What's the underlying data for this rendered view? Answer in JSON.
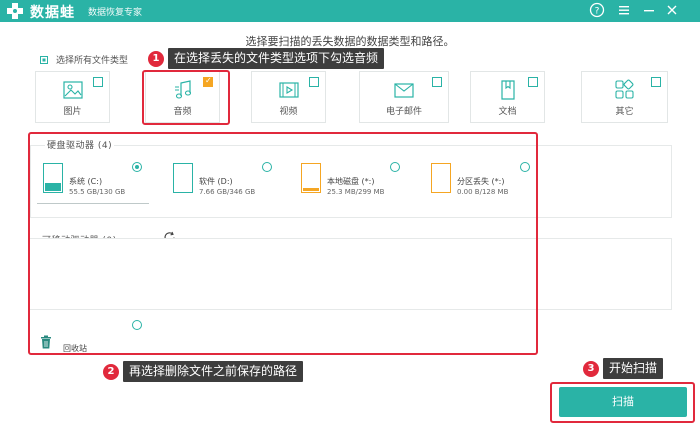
{
  "titlebar": {
    "app_name": "数据蛙",
    "app_subtitle": "数据恢复专家"
  },
  "instruction": "选择要扫描的丢失数据的数据类型和路径。",
  "select_all_label": "选择所有文件类型",
  "file_types": [
    {
      "label": "图片",
      "checked": false
    },
    {
      "label": "音频",
      "checked": true
    },
    {
      "label": "视频",
      "checked": false
    },
    {
      "label": "电子邮件",
      "checked": false
    },
    {
      "label": "文档",
      "checked": false
    },
    {
      "label": "其它",
      "checked": false
    }
  ],
  "hard_drives": {
    "title": "硬盘驱动器 (4)",
    "drives": [
      {
        "name": "系统 (C:)",
        "size": "55.5 GB/130 GB",
        "selected": true
      },
      {
        "name": "软件 (D:)",
        "size": "7.66 GB/346 GB",
        "selected": false
      },
      {
        "name": "本地磁盘 (*:)",
        "size": "25.3 MB/299 MB",
        "selected": false
      },
      {
        "name": "分区丢失 (*:)",
        "size": "0.00 B/128 MB",
        "selected": false
      }
    ]
  },
  "removable": {
    "title": "可移动驱动器 (0)"
  },
  "recycle_bin_label": "回收站",
  "annotations": {
    "step1": {
      "num": "1",
      "text": "在选择丢失的文件类型选项下勾选音频"
    },
    "step2": {
      "num": "2",
      "text": "再选择删除文件之前保存的路径"
    },
    "step3": {
      "num": "3",
      "text": "开始扫描"
    }
  },
  "scan_button": "扫描",
  "colors": {
    "accent": "#2ab3a6",
    "annotation_red": "#e1293c",
    "callout_bg": "#3d3d3d",
    "checked_orange": "#f5a623"
  }
}
